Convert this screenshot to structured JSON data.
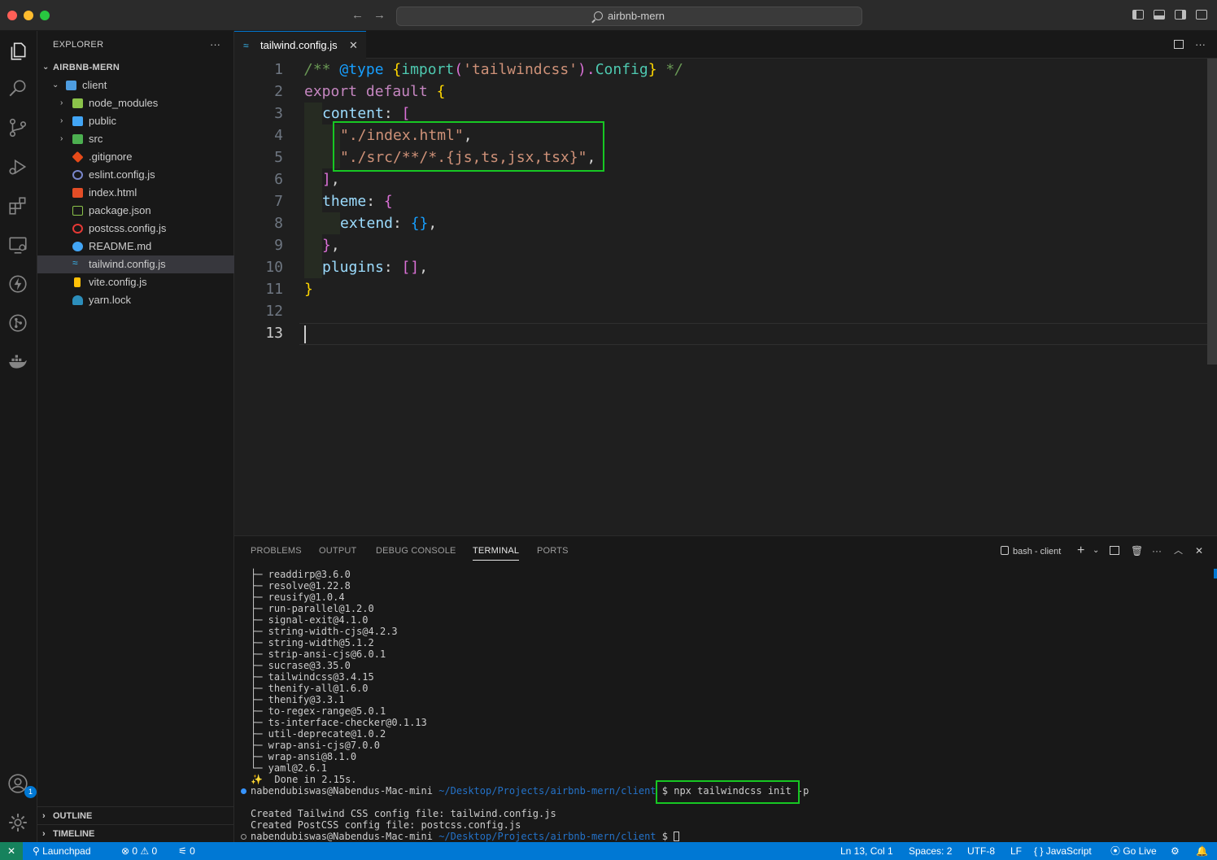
{
  "window": {
    "title": "airbnb-mern"
  },
  "sidebar": {
    "header": "EXPLORER",
    "more": "···",
    "project": "AIRBNB-MERN",
    "items": [
      {
        "label": "client",
        "chev": "⌄"
      },
      {
        "label": "node_modules",
        "chev": "›"
      },
      {
        "label": "public",
        "chev": "›"
      },
      {
        "label": "src",
        "chev": "›"
      },
      {
        "label": ".gitignore"
      },
      {
        "label": "eslint.config.js"
      },
      {
        "label": "index.html"
      },
      {
        "label": "package.json"
      },
      {
        "label": "postcss.config.js"
      },
      {
        "label": "README.md"
      },
      {
        "label": "tailwind.config.js"
      },
      {
        "label": "vite.config.js"
      },
      {
        "label": "yarn.lock"
      }
    ],
    "outline": "OUTLINE",
    "timeline": "TIMELINE"
  },
  "tab": {
    "label": "tailwind.config.js"
  },
  "editor": {
    "line_numbers": [
      "1",
      "2",
      "3",
      "4",
      "5",
      "6",
      "7",
      "8",
      "9",
      "10",
      "11",
      "12",
      "13"
    ],
    "lines": [
      [
        "/** ",
        "@type",
        " {",
        "import",
        "(",
        "'tailwindcss'",
        ").",
        "Config",
        "}",
        " */"
      ],
      [
        "export default ",
        "{"
      ],
      [
        "content",
        ": ",
        "["
      ],
      [
        "\"./index.html\"",
        ","
      ],
      [
        "\"./src/**/*.{js,ts,jsx,tsx}\"",
        ","
      ],
      [
        "]",
        ","
      ],
      [
        "theme",
        ": ",
        "{"
      ],
      [
        "extend",
        ": ",
        "{}",
        ","
      ],
      [
        "}",
        ","
      ],
      [
        "plugins",
        ": ",
        "[]",
        ","
      ],
      [
        "}"
      ]
    ]
  },
  "panel": {
    "tabs": [
      "PROBLEMS",
      "OUTPUT",
      "DEBUG CONSOLE",
      "TERMINAL",
      "PORTS"
    ],
    "shell": "bash - client",
    "terminal_lines": [
      "├─ readdirp@3.6.0",
      "├─ resolve@1.22.8",
      "├─ reusify@1.0.4",
      "├─ run-parallel@1.2.0",
      "├─ signal-exit@4.1.0",
      "├─ string-width-cjs@4.2.3",
      "├─ string-width@5.1.2",
      "├─ strip-ansi-cjs@6.0.1",
      "├─ sucrase@3.35.0",
      "├─ tailwindcss@3.4.15",
      "├─ thenify-all@1.6.0",
      "├─ thenify@3.3.1",
      "├─ to-regex-range@5.0.1",
      "├─ ts-interface-checker@0.1.13",
      "├─ util-deprecate@1.0.2",
      "├─ wrap-ansi-cjs@7.0.0",
      "├─ wrap-ansi@8.1.0",
      "└─ yaml@2.6.1",
      "✨  Done in 2.15s."
    ],
    "prompt_user": "nabendubiswas@Nabendus-Mac-mini",
    "prompt_path": "~/Desktop/Projects/airbnb-mern/client",
    "prompt_symbol": "$",
    "command": "npx tailwindcss init -p",
    "output": [
      "Created Tailwind CSS config file: tailwind.config.js",
      "Created PostCSS config file: postcss.config.js"
    ]
  },
  "status": {
    "remote": "✕",
    "launchpad": "Launchpad",
    "errors": "0",
    "warnings": "0",
    "ports": "0",
    "position": "Ln 13, Col 1",
    "spaces": "Spaces: 2",
    "encoding": "UTF-8",
    "eol": "LF",
    "language": "JavaScript",
    "golive": "Go Live"
  },
  "accounts_badge": "1",
  "colors": {
    "accent": "#0078d4",
    "highlight": "#17c723",
    "statusbar": "#0078d4"
  }
}
